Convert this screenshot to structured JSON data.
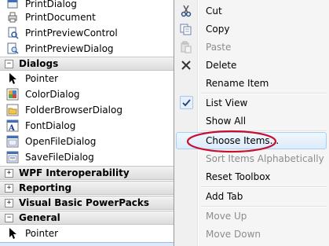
{
  "toolbox": {
    "items_top": [
      {
        "label": "PrintDialog",
        "icon": "print-dialog-icon"
      },
      {
        "label": "PrintDocument",
        "icon": "print-document-icon"
      },
      {
        "label": "PrintPreviewControl",
        "icon": "print-preview-control-icon"
      },
      {
        "label": "PrintPreviewDialog",
        "icon": "print-preview-dialog-icon"
      }
    ],
    "dialogs_header": {
      "label": "Dialogs",
      "state": "−"
    },
    "dialogs_items": [
      {
        "label": "Pointer",
        "icon": "pointer-icon"
      },
      {
        "label": "ColorDialog",
        "icon": "color-dialog-icon"
      },
      {
        "label": "FolderBrowserDialog",
        "icon": "folder-browser-dialog-icon"
      },
      {
        "label": "FontDialog",
        "icon": "font-dialog-icon"
      },
      {
        "label": "OpenFileDialog",
        "icon": "open-file-dialog-icon"
      },
      {
        "label": "SaveFileDialog",
        "icon": "save-file-dialog-icon"
      }
    ],
    "collapsed_headers": [
      {
        "label": "WPF Interoperability",
        "state": "+"
      },
      {
        "label": "Reporting",
        "state": "+"
      },
      {
        "label": "Visual Basic PowerPacks",
        "state": "+"
      }
    ],
    "general_header": {
      "label": "General",
      "state": "−"
    },
    "general_items": [
      {
        "label": "Pointer",
        "icon": "pointer-icon"
      }
    ]
  },
  "context_menu": {
    "cut": "Cut",
    "copy": "Copy",
    "paste": "Paste",
    "delete": "Delete",
    "rename_item": "Rename Item",
    "list_view": "List View",
    "show_all": "Show All",
    "choose_items": "Choose Items...",
    "sort_items": "Sort Items Alphabetically",
    "reset_toolbox": "Reset Toolbox",
    "add_tab": "Add Tab",
    "move_up": "Move Up",
    "move_down": "Move Down"
  },
  "colors": {
    "menu_background": "#f5f5f5",
    "hover_border": "#a8cff5",
    "highlight_ellipse": "#c8102e",
    "header_gradient_top": "#f3f3f3",
    "header_gradient_bottom": "#dcdcdc"
  }
}
